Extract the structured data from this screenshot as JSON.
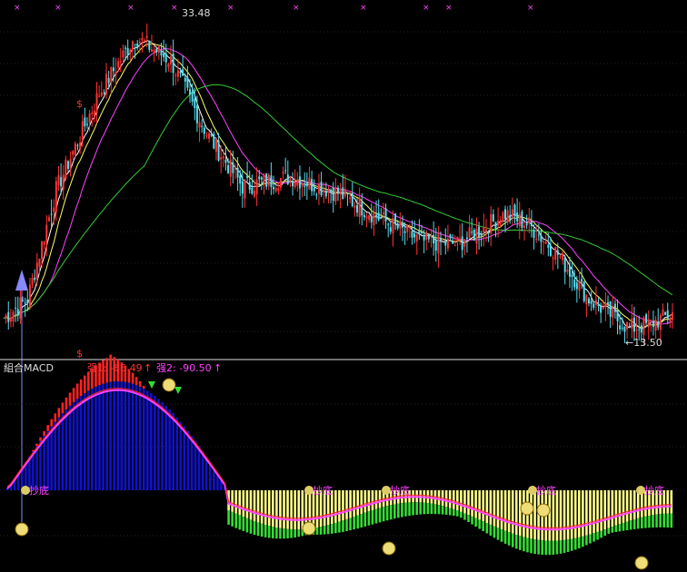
{
  "chart_data": [
    {
      "type": "candlestick",
      "annotations": {
        "high_label": "33.48",
        "low_label": "←13.50",
        "dollar_mark": "$"
      },
      "price_range": [
        12.5,
        34.5
      ],
      "x_markers_top": [
        "×",
        "×",
        "×",
        "×",
        "×",
        "×",
        "×",
        "×",
        "×",
        "×"
      ],
      "ma_colors": {
        "ma_short": "#ffffff",
        "ma_mid": "#ffff66",
        "ma_long": "#ff44ff",
        "ma_very_long": "#33cc33"
      },
      "candle_colors": {
        "up": "#ff3333",
        "down": "#55ddee"
      }
    },
    {
      "type": "bar",
      "title": "組合MACD",
      "legend": [
        {
          "label": "强1: -66.49",
          "arrow": "↑",
          "color": "#ff3333"
        },
        {
          "label": "强2: -90.50",
          "arrow": "↑",
          "color": "#ff44ff"
        }
      ],
      "bottom_labels": [
        "抄底",
        "抄底",
        "抄底",
        "抄底",
        "抄底"
      ],
      "colors": {
        "positive_main": "#1111cc",
        "positive_fill": "#ff2222",
        "negative_main": "#ffff88",
        "negative_fill": "#33dd33",
        "signal_line": "#ff44ff"
      }
    }
  ]
}
